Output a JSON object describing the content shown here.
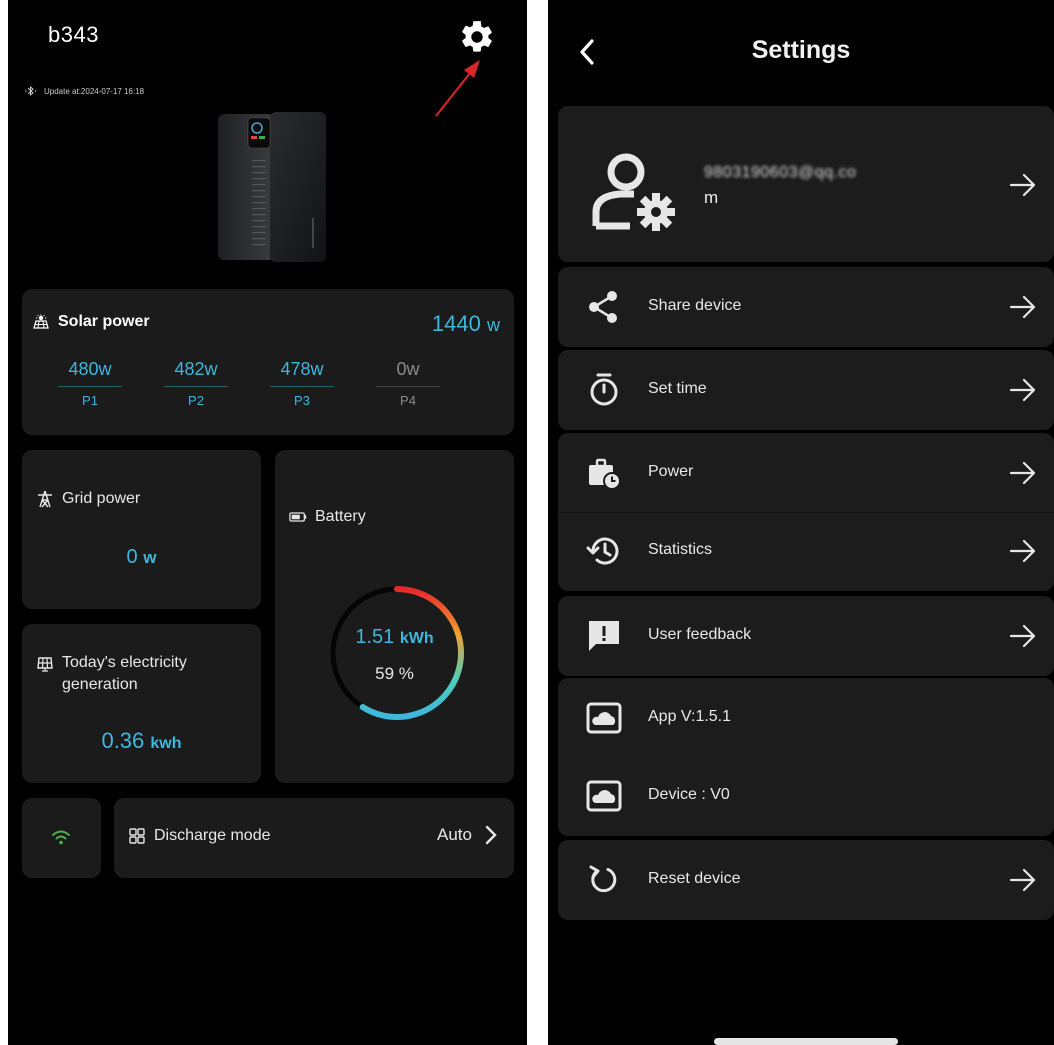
{
  "left_screen": {
    "device_name": "b343",
    "update_text": "Update at:2024-07-17 16:18",
    "solar": {
      "title": "Solar power",
      "total_value": "1440",
      "total_unit": "w",
      "panels": [
        {
          "value": "480w",
          "label": "P1",
          "active": true
        },
        {
          "value": "482w",
          "label": "P2",
          "active": true
        },
        {
          "value": "478w",
          "label": "P3",
          "active": true
        },
        {
          "value": "0w",
          "label": "P4",
          "active": false
        }
      ]
    },
    "grid": {
      "title": "Grid power",
      "value": "0",
      "unit": "w"
    },
    "generation": {
      "title_line1": "Today's electricity",
      "title_line2": "generation",
      "value": "0.36",
      "unit": "kwh"
    },
    "battery": {
      "title": "Battery",
      "energy_value": "1.51",
      "energy_unit": "kWh",
      "percent_text": "59 %",
      "level": 0.59
    },
    "discharge": {
      "title": "Discharge mode",
      "value": "Auto"
    }
  },
  "right_screen": {
    "title": "Settings",
    "account": {
      "email_masked": "9803190603@qq.co",
      "email_suffix": "m"
    },
    "items": [
      {
        "label": "Share device",
        "icon": "share-icon"
      },
      {
        "label": "Set time",
        "icon": "timer-icon"
      },
      {
        "label": "Power",
        "icon": "power-schedule-icon"
      },
      {
        "label": "Statistics",
        "icon": "history-icon"
      },
      {
        "label": "User feedback",
        "icon": "feedback-icon"
      },
      {
        "label": "App V:1.5.1",
        "icon": "cloud-icon"
      },
      {
        "label": "Device : V0",
        "icon": "cloud-icon"
      },
      {
        "label": "Reset device",
        "icon": "reset-icon"
      }
    ]
  },
  "colors": {
    "accent": "#3db7dd",
    "background": "#000000",
    "card": "#1b1b1b",
    "wifi": "#4caf50",
    "annotation": "#d8262b"
  }
}
